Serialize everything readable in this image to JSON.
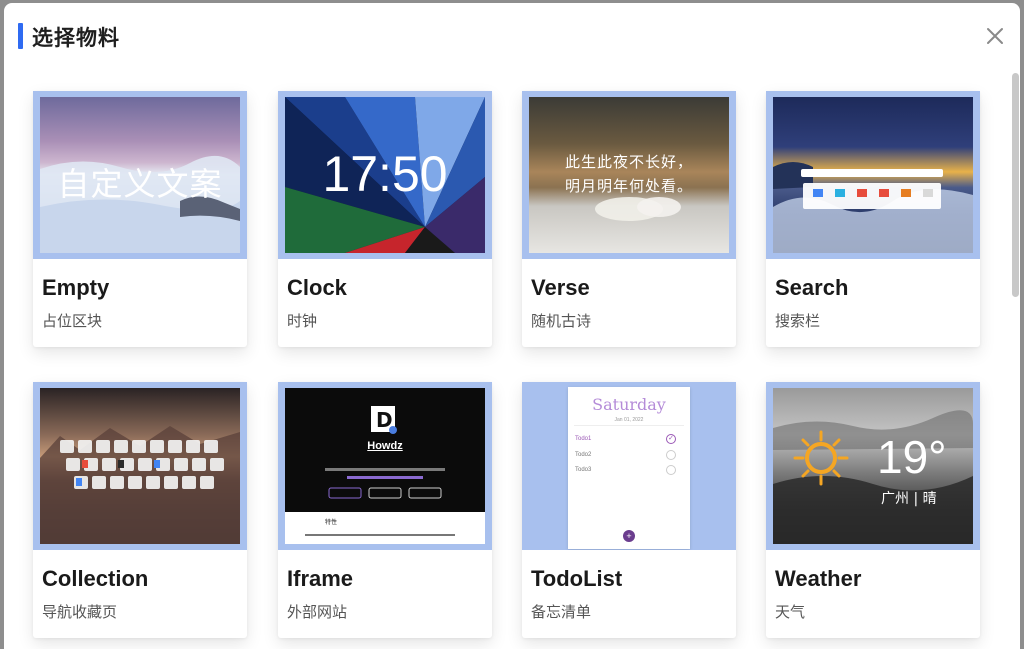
{
  "dialog": {
    "title": "选择物料"
  },
  "cards": [
    {
      "name": "Empty",
      "desc": "占位区块",
      "preview_text": "自定义文案"
    },
    {
      "name": "Clock",
      "desc": "时钟",
      "preview_time": "17:50"
    },
    {
      "name": "Verse",
      "desc": "随机古诗",
      "preview_line1": "此生此夜不长好，",
      "preview_line2": "明月明年何处看。"
    },
    {
      "name": "Search",
      "desc": "搜索栏"
    },
    {
      "name": "Collection",
      "desc": "导航收藏页"
    },
    {
      "name": "Iframe",
      "desc": "外部网站",
      "preview_title": "Howdz",
      "preview_section": "特性"
    },
    {
      "name": "TodoList",
      "desc": "备忘清单",
      "preview_day": "Saturday",
      "preview_date": "Jan 01, 2022",
      "todos": [
        "Todo1",
        "Todo2",
        "Todo3"
      ]
    },
    {
      "name": "Weather",
      "desc": "天气",
      "preview_temp": "19°",
      "preview_city": "广州 | 晴"
    }
  ],
  "colors": {
    "accent": "#2f6bf2",
    "thumb_frame": "#a8c0ee",
    "todo_accent": "#9b59b6"
  }
}
